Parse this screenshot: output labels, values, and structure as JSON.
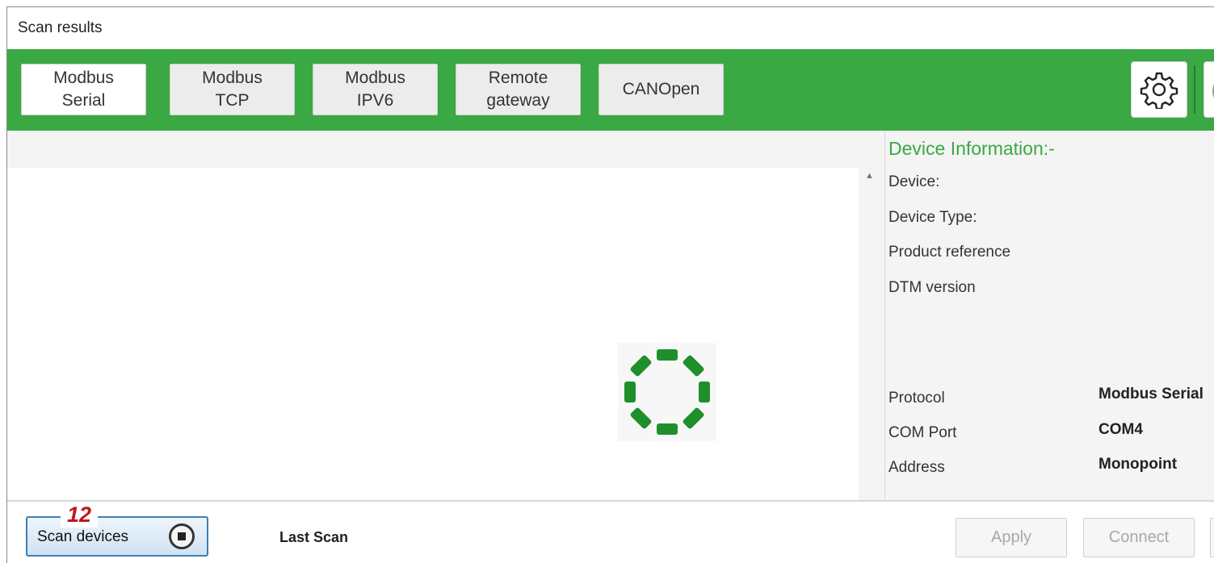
{
  "window": {
    "title": "Scan results"
  },
  "toolbar": {
    "tabs": [
      {
        "label": "Modbus\nSerial",
        "active": true
      },
      {
        "label": "Modbus\nTCP",
        "active": false
      },
      {
        "label": "Modbus\nIPV6",
        "active": false
      },
      {
        "label": "Remote\ngateway",
        "active": false
      },
      {
        "label": "CANOpen",
        "active": false
      }
    ],
    "settings_icon": "gear-icon",
    "accent_color": "#3aa843"
  },
  "device_info": {
    "title": "Device Information:-",
    "fields": [
      {
        "label": "Device:"
      },
      {
        "label": "Device Type:"
      },
      {
        "label": "Product reference"
      },
      {
        "label": "DTM version"
      }
    ],
    "connection": [
      {
        "label": "Protocol",
        "value": "Modbus Serial"
      },
      {
        "label": "COM Port",
        "value": "COM4"
      },
      {
        "label": "Address",
        "value": "Monopoint"
      }
    ]
  },
  "bottom": {
    "callout": "12",
    "scan_button_label": "Scan devices",
    "last_scan_label": "Last Scan",
    "apply_label": "Apply",
    "connect_label": "Connect"
  },
  "status": {
    "scanning": true,
    "spinner_icon": "loading-spinner-icon"
  }
}
